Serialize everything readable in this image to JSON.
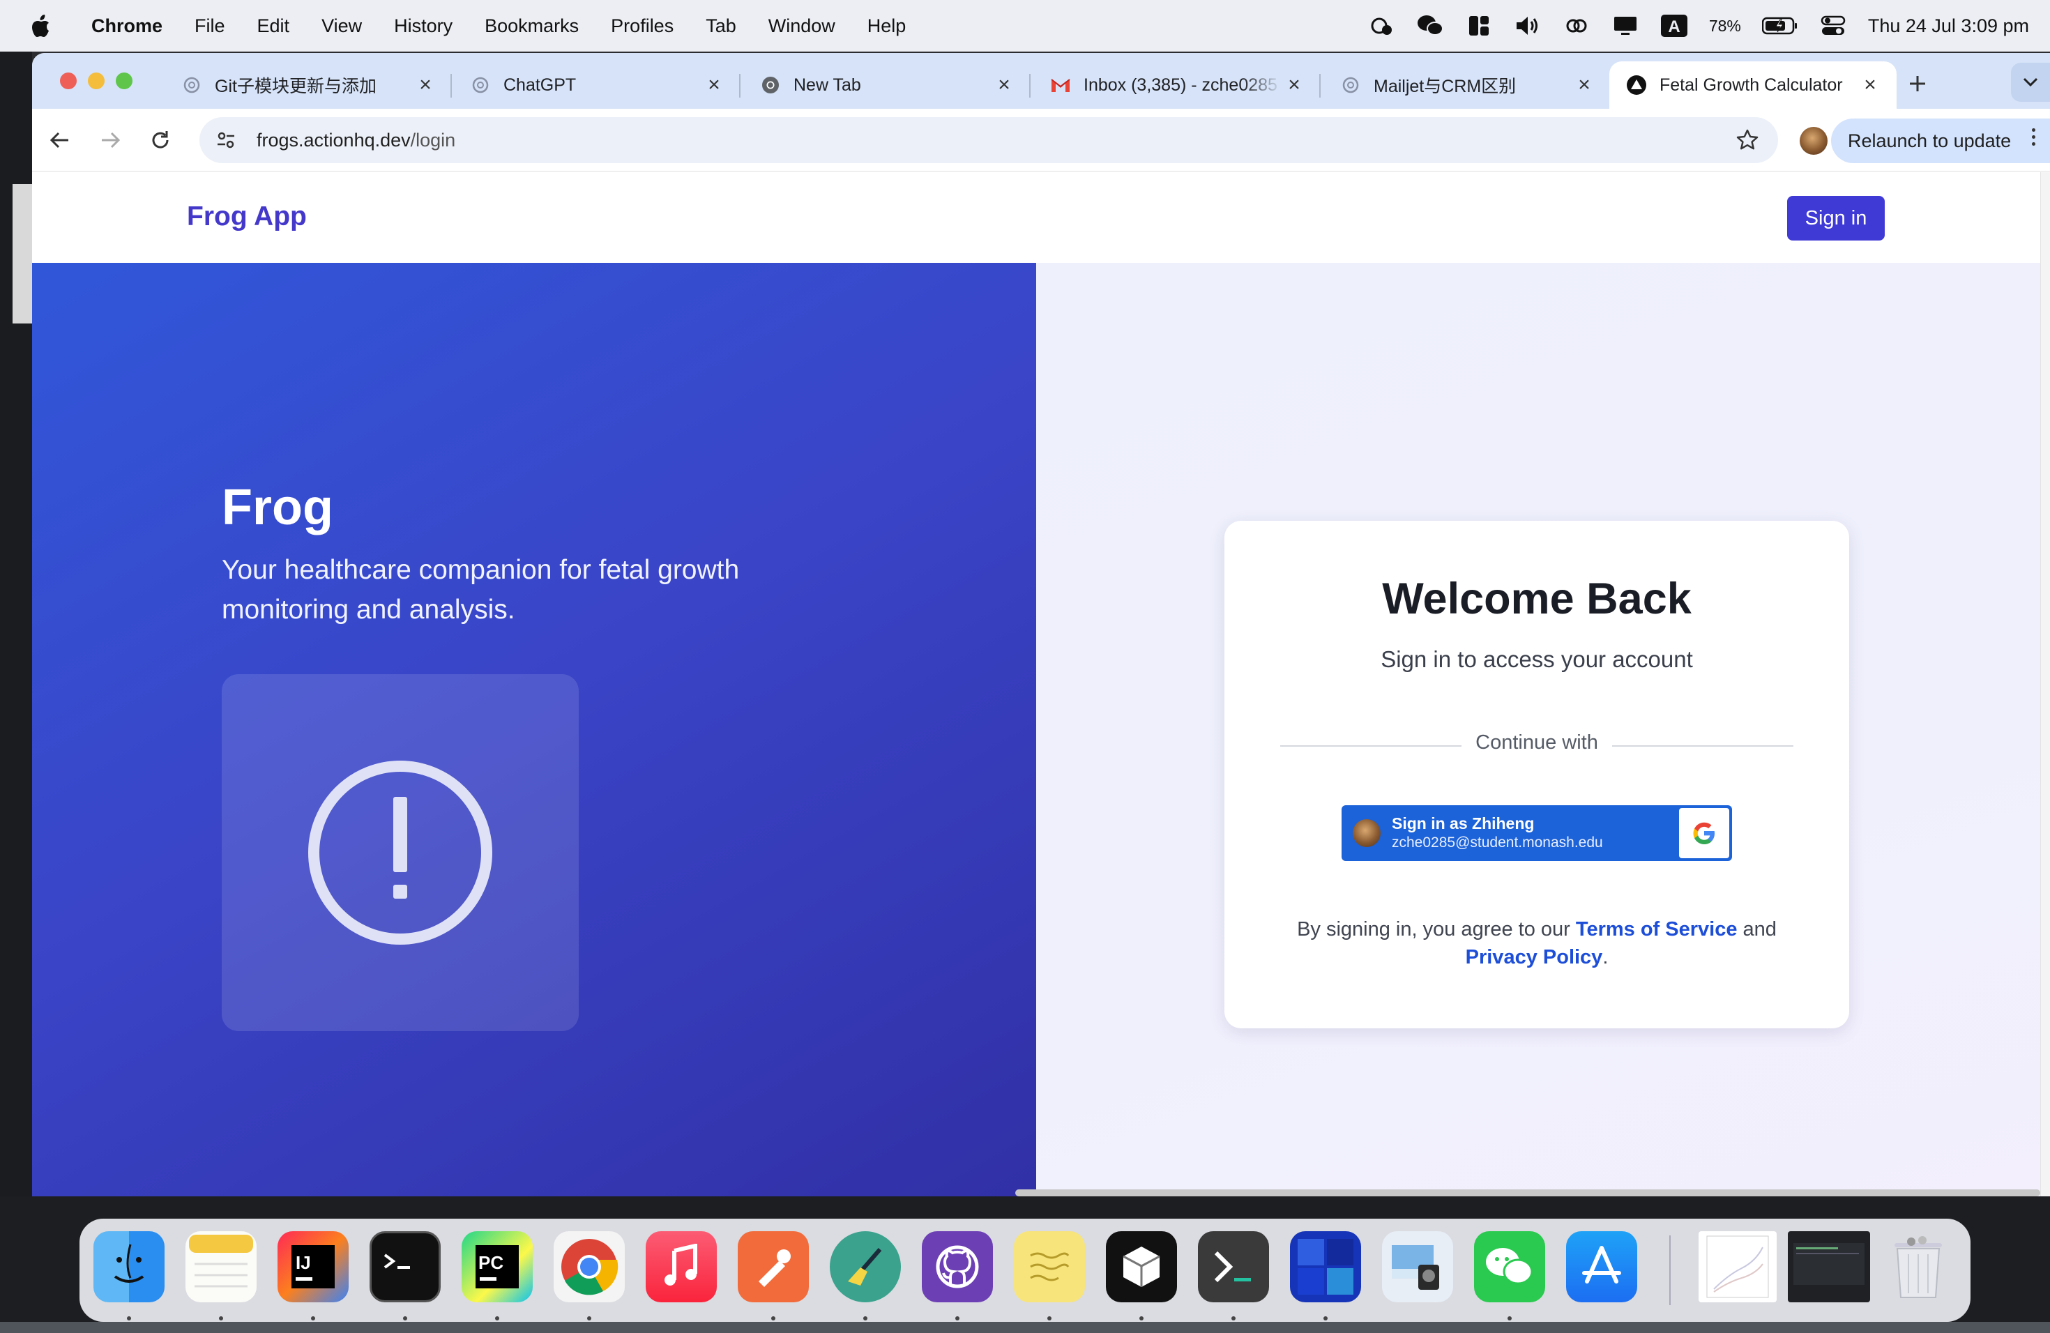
{
  "menubar": {
    "app_name": "Chrome",
    "items": [
      "File",
      "Edit",
      "View",
      "History",
      "Bookmarks",
      "Profiles",
      "Tab",
      "Window",
      "Help"
    ],
    "battery": "78%",
    "clock": "Thu 24 Jul  3:09 pm",
    "status_icons": [
      "screen-time-icon",
      "wechat-icon",
      "grid-icon",
      "volume-icon",
      "link-icon",
      "display-icon",
      "input-source-icon",
      "battery-icon",
      "control-center-icon"
    ],
    "input_source": "A"
  },
  "tabs": [
    {
      "title": "Git子模块更新与添加",
      "icon": "chatgpt-icon"
    },
    {
      "title": "ChatGPT",
      "icon": "chatgpt-icon"
    },
    {
      "title": "New Tab",
      "icon": "chrome-icon"
    },
    {
      "title": "Inbox (3,385) - zche0285",
      "icon": "gmail-icon"
    },
    {
      "title": "Mailjet与CRM区别",
      "icon": "chatgpt-icon"
    },
    {
      "title": "Fetal Growth Calculator",
      "icon": "site-triangle-icon",
      "active": true
    }
  ],
  "toolbar": {
    "url_host": "frogs.actionhq.dev",
    "url_path": "/login",
    "relaunch_label": "Relaunch to update"
  },
  "site": {
    "brand": "Frog App",
    "header_signin": "Sign in",
    "hero_title": "Frog",
    "hero_tagline": "Your healthcare companion for fetal growth monitoring and analysis.",
    "hero_icon": "alert-circle-icon",
    "card": {
      "title": "Welcome Back",
      "subtitle": "Sign in to access your account",
      "divider_label": "Continue with",
      "google_name": "Sign in as Zhiheng",
      "google_email": "zche0285@student.monash.edu",
      "legal_prefix": "By signing in, you agree to our ",
      "terms_label": "Terms of Service",
      "legal_mid": " and ",
      "privacy_label": "Privacy Policy",
      "legal_suffix": "."
    }
  },
  "dock": {
    "apps": [
      "finder-icon",
      "notes-icon",
      "intellij-icon",
      "terminal-icon",
      "pycharm-icon",
      "chrome-icon",
      "music-icon",
      "postman-icon",
      "broom-app-icon",
      "github-desktop-icon",
      "stickies-icon",
      "cube-app-icon",
      "terminal-prompt-icon",
      "blocks-app-icon",
      "preview-icon",
      "wechat-icon",
      "app-store-icon",
      "document-thumbnail",
      "window-thumbnail",
      "trash-icon"
    ]
  },
  "colors": {
    "brand": "#4338ca",
    "hero_start": "#3157d9",
    "hero_end": "#3130a6",
    "google_button": "#1c62d8",
    "link": "#1d4ed8"
  }
}
